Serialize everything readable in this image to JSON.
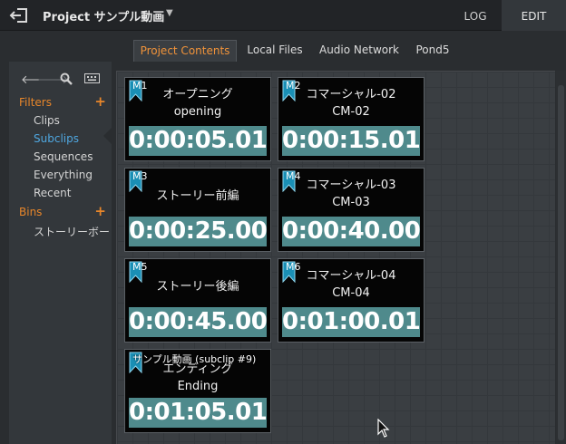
{
  "header": {
    "project_title": "Project サンプル動画",
    "modes": {
      "log": "LOG",
      "edit": "EDIT"
    }
  },
  "tabs": [
    {
      "label": "Project Contents",
      "active": true
    },
    {
      "label": "Local Files",
      "active": false
    },
    {
      "label": "Audio Network",
      "active": false
    },
    {
      "label": "Pond5",
      "active": false
    }
  ],
  "sidebar": {
    "filters_label": "Filters",
    "filters": [
      {
        "label": "Clips"
      },
      {
        "label": "Subclips",
        "selected": true
      },
      {
        "label": "Sequences"
      },
      {
        "label": "Everything"
      },
      {
        "label": "Recent"
      }
    ],
    "bins_label": "Bins",
    "bins": [
      {
        "label": "ストーリーボート"
      }
    ]
  },
  "clips": [
    {
      "marker": "M1",
      "title_line1": "オープニング",
      "title_line2": "opening",
      "duration": "0:00:05.01"
    },
    {
      "marker": "M2",
      "title_line1": "コマーシャル-02",
      "title_line2": "CM-02",
      "duration": "0:00:15.01"
    },
    {
      "marker": "M3",
      "title_line1": "ストーリー前編",
      "title_line2": "",
      "duration": "0:00:25.00"
    },
    {
      "marker": "M4",
      "title_line1": "コマーシャル-03",
      "title_line2": "CM-03",
      "duration": "0:00:40.00"
    },
    {
      "marker": "M5",
      "title_line1": "ストーリー後編",
      "title_line2": "",
      "duration": "0:00:45.00"
    },
    {
      "marker": "M6",
      "title_line1": "コマーシャル-04",
      "title_line2": "CM-04",
      "duration": "0:01:00.01"
    },
    {
      "marker": "",
      "overlay": "サンプル動画 (subclip #9)",
      "title_line1": "エンディング",
      "title_line2": "Ending",
      "duration": "0:01:05.01"
    }
  ],
  "colors": {
    "accent": "#e8862a",
    "selected": "#4fa7e0",
    "timecode_bg": "#4f8a8c",
    "marker_flag": "#1a8fb5"
  },
  "icons": [
    "exit-icon",
    "back-arrow-icon",
    "forward-arrow-icon",
    "search-icon",
    "keyboard-icon",
    "plus-icon",
    "marker-flag-icon",
    "cursor-icon"
  ]
}
